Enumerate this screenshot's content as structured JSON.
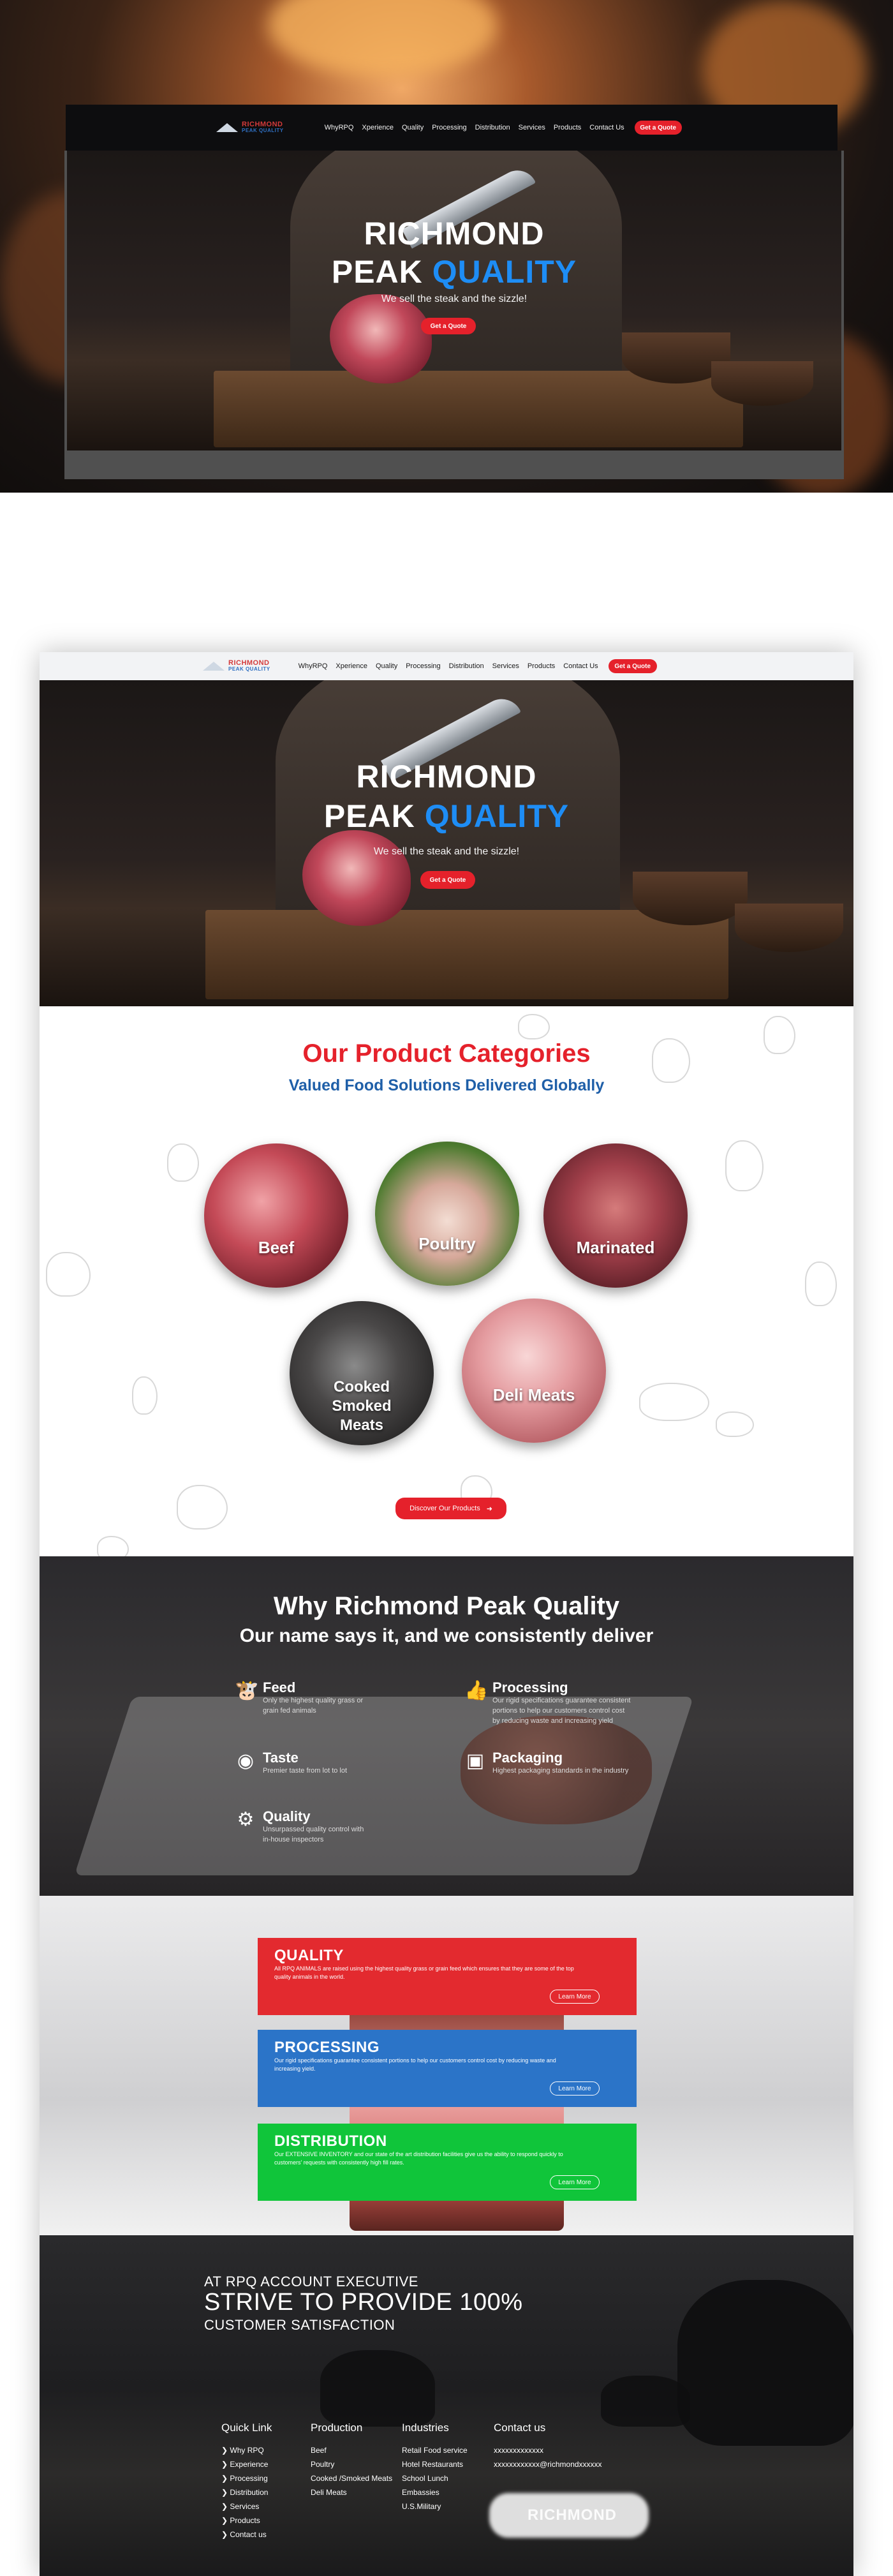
{
  "brand": {
    "logo_line1": "RICHMOND",
    "logo_line2": "PEAK QUALITY",
    "accent_red": "#e5212b",
    "accent_blue": "#1e8df5",
    "dark_blue": "#1f5fa8"
  },
  "nav": {
    "items": [
      "WhyRPQ",
      "Xperience",
      "Quality",
      "Processing",
      "Distribution",
      "Services",
      "Products",
      "Contact Us"
    ],
    "cta": "Get a Quote"
  },
  "hero": {
    "title_line1": "RICHMOND",
    "title_line2_white": "PEAK",
    "title_line2_blue": "QUALITY",
    "subtitle": "We sell the steak and the sizzle!",
    "cta": "Get a Quote"
  },
  "categories": {
    "heading": "Our Product Categories",
    "subheading": "Valued Food Solutions Delivered Globally",
    "items": [
      {
        "label": "Beef"
      },
      {
        "label": "Poultry"
      },
      {
        "label": "Marinated"
      },
      {
        "label": "Cooked Smoked Meats"
      },
      {
        "label": "Deli Meats"
      }
    ],
    "cta": "Discover Our Products"
  },
  "why": {
    "heading": "Why Richmond Peak Quality",
    "subheading": "Our name says it, and we consistently deliver",
    "features": [
      {
        "icon": "cow-icon",
        "title": "Feed",
        "desc": "Only the highest quality grass or grain fed animals"
      },
      {
        "icon": "thumbs-up-icon",
        "title": "Processing",
        "desc": "Our rigid specifications guarantee consistent portions to help our customers control cost by reducing waste and increasing yield"
      },
      {
        "icon": "steak-icon",
        "title": "Taste",
        "desc": "Premier taste from lot to lot"
      },
      {
        "icon": "box-icon",
        "title": "Packaging",
        "desc": "Highest packaging standards in the industry"
      },
      {
        "icon": "gear-icon",
        "title": "Quality",
        "desc": "Unsurpassed quality control with in-house inspectors"
      }
    ]
  },
  "qpd": {
    "cards": [
      {
        "title": "QUALITY",
        "color": "#e32a2f",
        "text": "All RPQ ANIMALS are raised using the highest quality grass or grain feed which ensures that they are some of the top quality animals in the world.",
        "cta": "Learn More"
      },
      {
        "title": "PROCESSING",
        "color": "#2b74c8",
        "text": "Our rigid specifications guarantee consistent portions to help our customers control cost by reducing waste and increasing yield.",
        "cta": "Learn More"
      },
      {
        "title": "DISTRIBUTION",
        "color": "#10c53a",
        "text": "Our EXTENSIVE INVENTORY and our state of the art distribution facilities give us the ability to respond quickly to customers' requests with consistently high fill rates.",
        "cta": "Learn More"
      }
    ]
  },
  "footer": {
    "line1": "AT RPQ ACCOUNT EXECUTIVE",
    "line2": "STRIVE TO PROVIDE 100%",
    "line3": "CUSTOMER SATISFACTION",
    "columns": [
      {
        "heading": "Quick Link",
        "items": [
          "Why RPQ",
          "Experience",
          "Processing",
          "Distribution",
          "Services",
          "Products",
          "Contact us"
        ]
      },
      {
        "heading": "Production",
        "items": [
          "Beef",
          "Poultry",
          "Cooked /Smoked Meats",
          "Deli Meats"
        ]
      },
      {
        "heading": "Industries",
        "items": [
          "Retail Food service",
          "Hotel Restaurants",
          "School Lunch",
          "Embassies",
          "U.S.Military"
        ]
      },
      {
        "heading": "Contact us",
        "items": [
          "xxxxxxxxxxxxx",
          "xxxxxxxxxxxx@richmondxxxxxx"
        ]
      }
    ],
    "logo_text": "RICHMOND"
  }
}
